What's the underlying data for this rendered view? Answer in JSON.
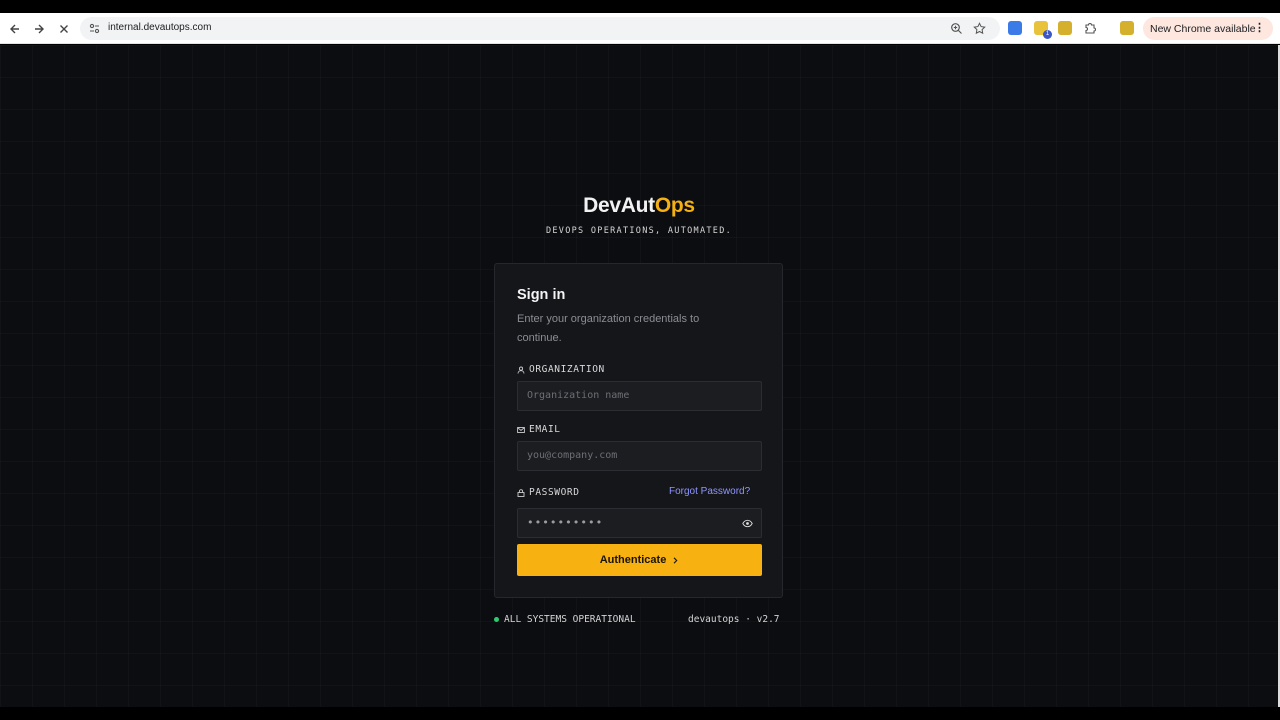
{
  "browser": {
    "url": "internal.devautops.com",
    "update_label": "New Chrome available",
    "extension_badge": "1",
    "colors": {
      "pill_bg": "#fde7df",
      "omnibox_bg": "#f1f3f4"
    }
  },
  "brand": {
    "name_main": "DevAut",
    "name_accent": "Ops",
    "tagline": "DEVOPS OPERATIONS, AUTOMATED.",
    "accent_color": "#f5b014"
  },
  "signin": {
    "title": "Sign in",
    "subtitle": "Enter your organization credentials to continue.",
    "organization": {
      "label": "ORGANIZATION",
      "placeholder": "Organization name",
      "icon": "user-icon"
    },
    "email": {
      "label": "EMAIL",
      "placeholder": "you@company.com",
      "icon": "mail-icon"
    },
    "password": {
      "label": "PASSWORD",
      "value": "••••••••••",
      "icon": "lock-icon",
      "forgot_label": "Forgot Password?"
    },
    "submit_label": "Authenticate",
    "button_color": "#f7b211"
  },
  "footer": {
    "status": "ALL SYSTEMS OPERATIONAL",
    "status_color": "#2ecc71",
    "version": "devautops · v2.7"
  }
}
